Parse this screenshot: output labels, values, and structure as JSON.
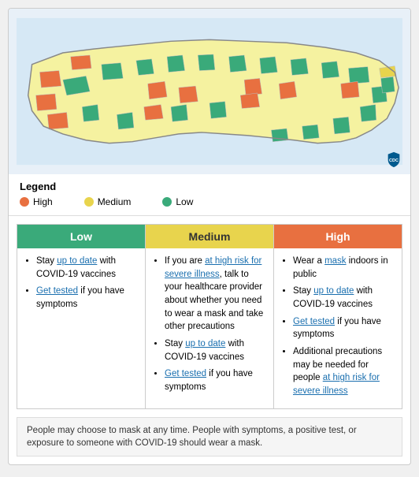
{
  "legend": {
    "title": "Legend",
    "items": [
      {
        "label": "High",
        "color": "#e87040"
      },
      {
        "label": "Medium",
        "color": "#e8d44d"
      },
      {
        "label": "Low",
        "color": "#3aaa7a"
      }
    ]
  },
  "cdc": {
    "logo_text": "CDC"
  },
  "risk_levels": {
    "low": {
      "header": "Low",
      "bullets": [
        "Stay up to date with COVID-19 vaccines",
        "Get tested if you have symptoms"
      ],
      "links": {
        "up_to_date": "up to date",
        "get_tested": "Get tested"
      }
    },
    "medium": {
      "header": "Medium",
      "bullets": [
        "If you are at high risk for severe illness, talk to your healthcare provider about whether you need to wear a mask and take other precautions",
        "Stay up to date with COVID-19 vaccines",
        "Get tested if you have symptoms"
      ],
      "links": {
        "high_risk": "at high risk for severe illness",
        "up_to_date": "up to date",
        "get_tested": "Get tested"
      }
    },
    "high": {
      "header": "High",
      "bullets": [
        "Wear a mask indoors in public",
        "Stay up to date with COVID-19 vaccines",
        "Get tested if you have symptoms",
        "Additional precautions may be needed for people at high risk for severe illness"
      ],
      "links": {
        "mask": "mask",
        "up_to_date": "up to date",
        "get_tested": "Get tested",
        "high_risk": "at high risk for severe illness"
      }
    }
  },
  "footer": {
    "text": "People may choose to mask at any time. People with symptoms, a positive test, or exposure to someone with COVID-19 should wear a mask."
  }
}
